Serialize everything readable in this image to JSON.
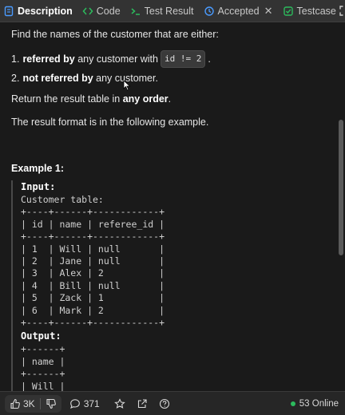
{
  "tabs": [
    {
      "label": "Description",
      "icon": "description-icon",
      "active": true
    },
    {
      "label": "Code",
      "icon": "code-icon"
    },
    {
      "label": "Test Result",
      "icon": "terminal-icon"
    },
    {
      "label": "Accepted",
      "icon": "history-icon"
    },
    {
      "label": "Testcase",
      "icon": "checkbox-icon"
    }
  ],
  "problem": {
    "intro": "Find the names of the customer that are either:",
    "item1_num": "1.",
    "item1_bold": "referred by",
    "item1_text": "any customer with",
    "item1_code": "id != 2",
    "item1_end": ".",
    "item2_num": "2.",
    "item2_bold": "not referred by",
    "item2_text": "any customer.",
    "order_pre": "Return the result table in",
    "order_bold": "any order",
    "order_end": ".",
    "format": "The result format is in the following example."
  },
  "example": {
    "heading": "Example 1:",
    "input_label": "Input:",
    "table_caption": "Customer table:",
    "customer_table": "+----+------+------------+\n| id | name | referee_id |\n+----+------+------------+\n| 1  | Will | null       |\n| 2  | Jane | null       |\n| 3  | Alex | 2          |\n| 4  | Bill | null       |\n| 5  | Zack | 1          |\n| 6  | Mark | 2          |\n+----+------+------------+",
    "output_label": "Output:",
    "output_table": "+------+\n| name |\n+------+\n| Will |"
  },
  "footer": {
    "likes": "3K",
    "comments": "371",
    "online": "53 Online"
  },
  "colors": {
    "accent_blue": "#4a9bff",
    "online_green": "#2cbb5d",
    "code_orange": "#f0a020"
  }
}
